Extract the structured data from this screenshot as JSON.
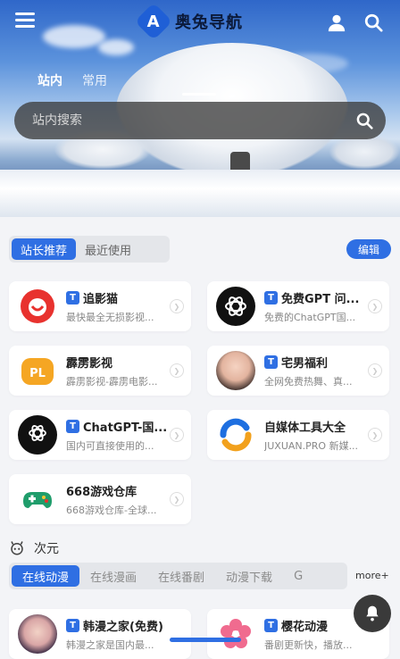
{
  "header": {
    "logo_letter": "A",
    "title": "奥兔导航"
  },
  "search": {
    "tabs": [
      {
        "label": "站内",
        "active": true
      },
      {
        "label": "常用",
        "active": false
      }
    ],
    "placeholder": "站内搜索"
  },
  "recommend": {
    "segments": [
      {
        "label": "站长推荐",
        "active": true
      },
      {
        "label": "最近使用",
        "active": false
      }
    ],
    "edit_label": "编辑",
    "cards": [
      {
        "badge": "T",
        "title": "追影猫",
        "desc": "最快最全无损影视...",
        "icon": "zhuiyingmao-logo"
      },
      {
        "badge": "T",
        "title": "免费GPT 问...",
        "desc": "免费的ChatGPT国...",
        "icon": "openai-logo"
      },
      {
        "badge": "",
        "title": "霹雳影视",
        "desc": "霹雳影视-霹雳电影...",
        "icon": "pl-logo"
      },
      {
        "badge": "T",
        "title": "宅男福利",
        "desc": "全网免费热舞、真...",
        "icon": "avatar-girl"
      },
      {
        "badge": "T",
        "title": "ChatGPT-国...",
        "desc": "国内可直接使用的...",
        "icon": "chatgpt-logo"
      },
      {
        "badge": "",
        "title": "自媒体工具大全",
        "desc": "JUXUAN.PRO 新媒...",
        "icon": "juxuan-logo"
      },
      {
        "badge": "",
        "title": "668游戏仓库",
        "desc": "668游戏仓库-全球...",
        "icon": "gamepad-logo"
      }
    ]
  },
  "category": {
    "title": "次元",
    "tabs": [
      {
        "label": "在线动漫",
        "active": true
      },
      {
        "label": "在线漫画",
        "active": false
      },
      {
        "label": "在线番剧",
        "active": false
      },
      {
        "label": "动漫下载",
        "active": false
      },
      {
        "label": "G",
        "active": false
      }
    ],
    "more_label": "more+",
    "cards": [
      {
        "badge": "T",
        "title": "韩漫之家(免费)",
        "desc": "韩漫之家是国内最...",
        "icon": "avatar-anime"
      },
      {
        "badge": "T",
        "title": "樱花动漫",
        "desc": "番剧更新快，播放...",
        "icon": "sakura-logo"
      }
    ]
  },
  "colors": {
    "accent": "#2f6fe3",
    "background": "#f3f4f7"
  }
}
